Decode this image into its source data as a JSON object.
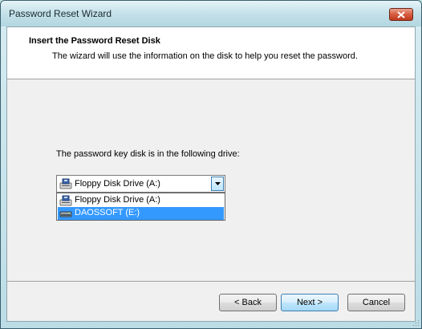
{
  "window": {
    "title": "Password Reset Wizard"
  },
  "header": {
    "title": "Insert the Password Reset Disk",
    "subtitle": "The wizard will use the information on the disk to help you reset the password."
  },
  "body": {
    "prompt": "The password key disk is in the following drive:"
  },
  "drive_select": {
    "selected": "Floppy Disk Drive (A:)",
    "options": [
      {
        "label": "Floppy Disk Drive (A:)",
        "icon": "floppy-drive-icon",
        "highlighted": false
      },
      {
        "label": "DAOSSOFT (E:)",
        "icon": "usb-drive-icon",
        "highlighted": true
      }
    ]
  },
  "buttons": {
    "back": "< Back",
    "next": "Next >",
    "cancel": "Cancel"
  },
  "colors": {
    "selection": "#3399ff",
    "close": "#c13a1e"
  }
}
